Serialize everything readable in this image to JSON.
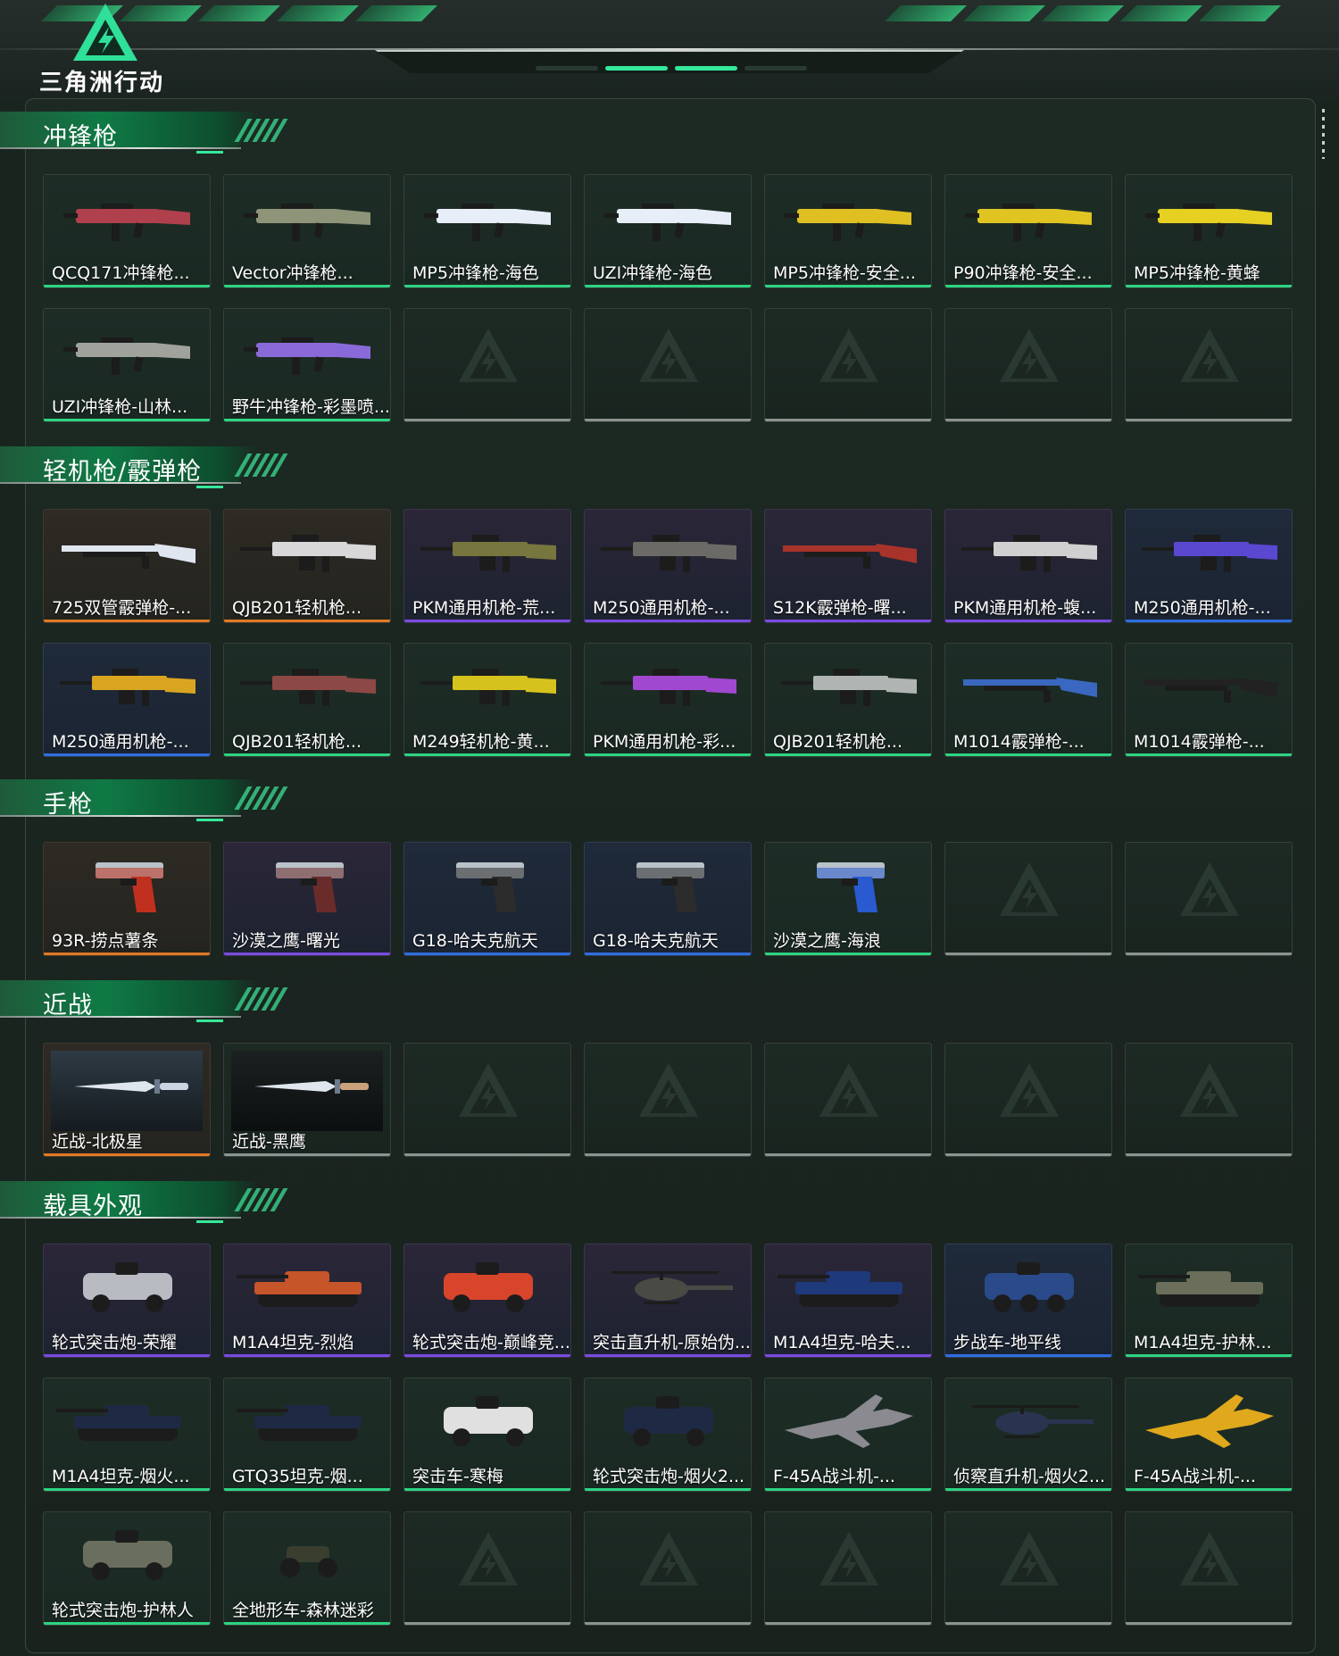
{
  "brand": {
    "logo_text": "三角洲行动"
  },
  "colors": {
    "accent": "#35e89a",
    "rarity_green": "#2ed483",
    "rarity_purple": "#7a4be0",
    "rarity_orange": "#e07a26",
    "rarity_blue": "#2f6ee0",
    "empty": "#8d9390"
  },
  "sections": [
    {
      "title": "冲锋枪",
      "rows": [
        [
          {
            "label": "QCQ171冲锋枪...",
            "rarity": "green",
            "icon": "smg-icon",
            "color": "#b0404c"
          },
          {
            "label": "Vector冲锋枪...",
            "rarity": "green",
            "icon": "smg-icon",
            "color": "#8d9478"
          },
          {
            "label": "MP5冲锋枪-海色",
            "rarity": "green",
            "icon": "smg-icon",
            "color": "#e8eef8"
          },
          {
            "label": "UZI冲锋枪-海色",
            "rarity": "green",
            "icon": "smg-icon",
            "color": "#e8eef8"
          },
          {
            "label": "MP5冲锋枪-安全...",
            "rarity": "green",
            "icon": "smg-icon",
            "color": "#e0bf22"
          },
          {
            "label": "P90冲锋枪-安全...",
            "rarity": "green",
            "icon": "smg-icon",
            "color": "#e0c422"
          },
          {
            "label": "MP5冲锋枪-黄蜂",
            "rarity": "green",
            "icon": "smg-icon",
            "color": "#e6d021"
          }
        ],
        [
          {
            "label": "UZI冲锋枪-山林...",
            "rarity": "green",
            "icon": "smg-icon",
            "color": "#9fa39c"
          },
          {
            "label": "野牛冲锋枪-彩墨喷...",
            "rarity": "green",
            "icon": "smg-icon",
            "color": "#8a6ad8"
          },
          {
            "label": "",
            "rarity": "empty"
          },
          {
            "label": "",
            "rarity": "empty"
          },
          {
            "label": "",
            "rarity": "empty"
          },
          {
            "label": "",
            "rarity": "empty"
          },
          {
            "label": "",
            "rarity": "empty"
          }
        ]
      ]
    },
    {
      "title": "轻机枪/霰弹枪",
      "rows": [
        [
          {
            "label": "725双管霰弹枪-...",
            "rarity": "orange",
            "icon": "shotgun-icon",
            "color": "#dfe6f0"
          },
          {
            "label": "QJB201轻机枪...",
            "rarity": "orange",
            "icon": "lmg-icon",
            "color": "#d8d8d8"
          },
          {
            "label": "PKM通用机枪-荒...",
            "rarity": "purple",
            "icon": "lmg-icon",
            "color": "#77763e"
          },
          {
            "label": "M250通用机枪-...",
            "rarity": "purple",
            "icon": "lmg-icon",
            "color": "#6c6a66"
          },
          {
            "label": "S12K霰弹枪-曙...",
            "rarity": "purple",
            "icon": "shotgun-icon",
            "color": "#a8332a"
          },
          {
            "label": "PKM通用机枪-蝮...",
            "rarity": "purple",
            "icon": "lmg-icon",
            "color": "#d0d0d0"
          },
          {
            "label": "M250通用机枪-...",
            "rarity": "blue",
            "icon": "lmg-icon",
            "color": "#5a48d0"
          }
        ],
        [
          {
            "label": "M250通用机枪-...",
            "rarity": "blue",
            "icon": "lmg-icon",
            "color": "#d9a521"
          },
          {
            "label": "QJB201轻机枪...",
            "rarity": "green",
            "icon": "lmg-icon",
            "color": "#8c4845"
          },
          {
            "label": "M249轻机枪-黄...",
            "rarity": "green",
            "icon": "lmg-icon",
            "color": "#d6c21d"
          },
          {
            "label": "PKM通用机枪-彩...",
            "rarity": "green",
            "icon": "lmg-icon",
            "color": "#a148d0"
          },
          {
            "label": "QJB201轻机枪...",
            "rarity": "green",
            "icon": "lmg-icon",
            "color": "#b0b4b2"
          },
          {
            "label": "M1014霰弹枪-...",
            "rarity": "green",
            "icon": "shotgun-icon",
            "color": "#3a68c0"
          },
          {
            "label": "M1014霰弹枪-...",
            "rarity": "green",
            "icon": "shotgun-icon",
            "color": "#222222"
          }
        ]
      ]
    },
    {
      "title": "手枪",
      "rows": [
        [
          {
            "label": "93R-捞点薯条",
            "rarity": "orange",
            "icon": "pistol-icon",
            "color": "#c0301f"
          },
          {
            "label": "沙漠之鹰-曙光",
            "rarity": "purple",
            "icon": "pistol-icon",
            "color": "#6a2c2a"
          },
          {
            "label": "G18-哈夫克航天",
            "rarity": "blue",
            "icon": "pistol-icon",
            "color": "#2c2c2c"
          },
          {
            "label": "G18-哈夫克航天",
            "rarity": "blue",
            "icon": "pistol-icon",
            "color": "#2c2c2c"
          },
          {
            "label": "沙漠之鹰-海浪",
            "rarity": "green",
            "icon": "pistol-icon",
            "color": "#2a5ad0"
          },
          {
            "label": "",
            "rarity": "empty"
          },
          {
            "label": "",
            "rarity": "empty"
          }
        ]
      ]
    },
    {
      "title": "近战",
      "rows": [
        [
          {
            "label": "近战-北极星",
            "rarity": "orange",
            "icon": "knife-icon",
            "color": "#c8d4e0",
            "photo": "light"
          },
          {
            "label": "近战-黑鹰",
            "rarity": "empty",
            "icon": "knife-icon",
            "color": "#c9a27c",
            "photo": "dark"
          },
          {
            "label": "",
            "rarity": "empty"
          },
          {
            "label": "",
            "rarity": "empty"
          },
          {
            "label": "",
            "rarity": "empty"
          },
          {
            "label": "",
            "rarity": "empty"
          },
          {
            "label": "",
            "rarity": "empty"
          }
        ]
      ]
    },
    {
      "title": "载具外观",
      "rows": [
        [
          {
            "label": "轮式突击炮-荣耀",
            "rarity": "purple",
            "icon": "armored-car-icon",
            "color": "#b8bcc2"
          },
          {
            "label": "M1A4坦克-烈焰",
            "rarity": "purple",
            "icon": "tank-icon",
            "color": "#c6552a"
          },
          {
            "label": "轮式突击炮-巅峰竞...",
            "rarity": "purple",
            "icon": "armored-car-icon",
            "color": "#d8452a"
          },
          {
            "label": "突击直升机-原始伪...",
            "rarity": "purple",
            "icon": "helicopter-icon",
            "color": "#4a4a44"
          },
          {
            "label": "M1A4坦克-哈夫...",
            "rarity": "purple",
            "icon": "tank-icon",
            "color": "#1f3a7a"
          },
          {
            "label": "步战车-地平线",
            "rarity": "blue",
            "icon": "ifv-icon",
            "color": "#2a4a8a"
          },
          {
            "label": "M1A4坦克-护林...",
            "rarity": "green",
            "icon": "tank-icon",
            "color": "#6a6e5a"
          }
        ],
        [
          {
            "label": "M1A4坦克-烟火...",
            "rarity": "green",
            "icon": "tank-icon",
            "color": "#1e2a44"
          },
          {
            "label": "GTQ35坦克-烟...",
            "rarity": "green",
            "icon": "tank-icon",
            "color": "#1e2a44"
          },
          {
            "label": "突击车-寒梅",
            "rarity": "green",
            "icon": "assault-vehicle-icon",
            "color": "#e0e0e0"
          },
          {
            "label": "轮式突击炮-烟火2...",
            "rarity": "green",
            "icon": "armored-car-icon",
            "color": "#1e2a44"
          },
          {
            "label": "F-45A战斗机-...",
            "rarity": "green",
            "icon": "jet-icon",
            "color": "#8a8a90"
          },
          {
            "label": "侦察直升机-烟火2...",
            "rarity": "green",
            "icon": "helicopter-icon",
            "color": "#2a3450"
          },
          {
            "label": "F-45A战斗机-...",
            "rarity": "green",
            "icon": "jet-icon",
            "color": "#e0a81c"
          }
        ],
        [
          {
            "label": "轮式突击炮-护林人",
            "rarity": "green",
            "icon": "armored-car-icon",
            "color": "#6a6e5e"
          },
          {
            "label": "全地形车-森林迷彩",
            "rarity": "green",
            "icon": "atv-icon",
            "color": "#3a3e2e"
          },
          {
            "label": "",
            "rarity": "empty"
          },
          {
            "label": "",
            "rarity": "empty"
          },
          {
            "label": "",
            "rarity": "empty"
          },
          {
            "label": "",
            "rarity": "empty"
          },
          {
            "label": "",
            "rarity": "empty"
          }
        ]
      ]
    }
  ]
}
